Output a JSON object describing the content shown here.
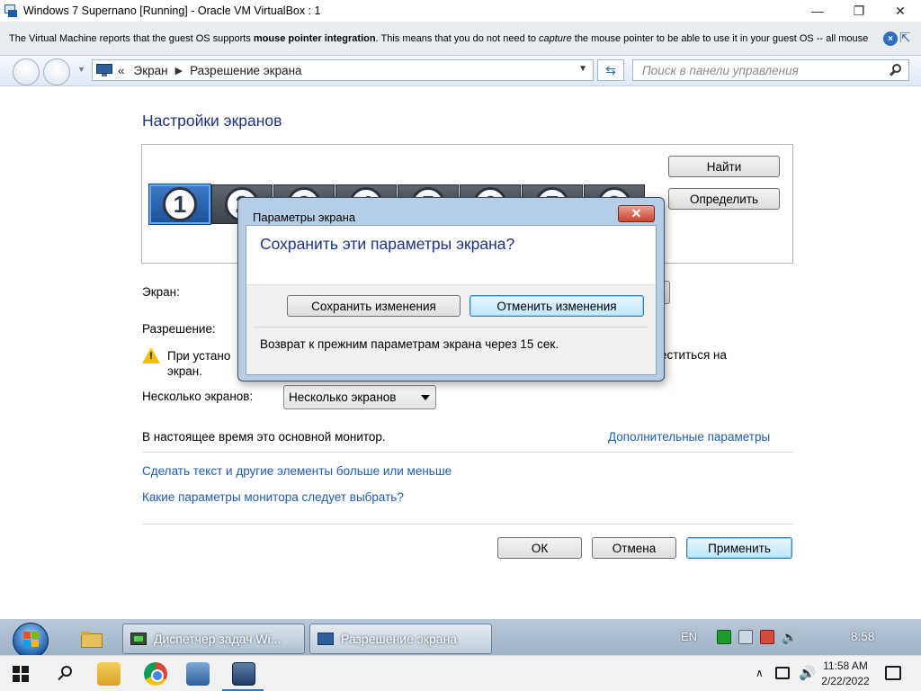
{
  "host": {
    "title": "Windows 7 Supernano [Running] - Oracle VM VirtualBox : 1",
    "controls": {
      "minimize": "—",
      "restore": "❐",
      "close": "✕"
    }
  },
  "notification": {
    "text_1": "The Virtual Machine reports that the guest OS supports ",
    "text_bold": "mouse pointer integration",
    "text_2": ". This means that you do not need to ",
    "text_italic": "capture",
    "text_3": " the mouse pointer to be able to use it in your guest OS -- all mouse",
    "close_glyph": "×",
    "mouse_glyph": "⇱"
  },
  "nav": {
    "history_glyph": "▼",
    "breadcrumb_sep": "«",
    "crumbs": [
      "Экран",
      "Разрешение экрана"
    ],
    "crumb_arrow": "▶",
    "drop_glyph": "▼",
    "refresh_glyph": "⇆",
    "search_placeholder": "Поиск в панели управления"
  },
  "content": {
    "title": "Настройки экранов",
    "monitors": [
      "1",
      "2",
      "3",
      "4",
      "5",
      "6",
      "7",
      "8"
    ],
    "find_label": "Найти",
    "identify_label": "Определить",
    "screen_label": "Экран:",
    "resolution_label": "Разрешение:",
    "warning_glyph": "!",
    "warning_line1": "При устано",
    "warning_line2": "экран.",
    "warning_right": "еститься на",
    "multi_label": "Несколько экранов:",
    "multi_value": "Несколько экранов",
    "primary_text": "В настоящее время это основной монитор.",
    "advanced_link": "Дополнительные параметры",
    "text_size_link": "Сделать текст и другие элементы больше или меньше",
    "monitor_link": "Какие параметры монитора следует выбрать?",
    "ok_label": "ОК",
    "cancel_label": "Отмена",
    "apply_label": "Применить"
  },
  "dialog": {
    "title": "Параметры экрана",
    "close_glyph": "✕",
    "question": "Сохранить эти параметры экрана?",
    "save_label": "Сохранить изменения",
    "revert_label": "Отменить изменения",
    "countdown": "Возврат к прежним параметрам экрана через 15 сек."
  },
  "guest_taskbar": {
    "task1": "Диспетчер задач Wi...",
    "task2": "Разрешение экрана",
    "lang": "EN",
    "volume_glyph": "🔊",
    "clock": "8:58"
  },
  "host_taskbar": {
    "tray_arrow": "∧",
    "volume_glyph": "🔊",
    "time": "11:58 AM",
    "date": "2/22/2022"
  },
  "colors": {
    "title_blue": "#1e3287",
    "link_blue": "#1e5bb5",
    "dialog_frame": "#b6cde6",
    "close_red": "#c9462f"
  }
}
